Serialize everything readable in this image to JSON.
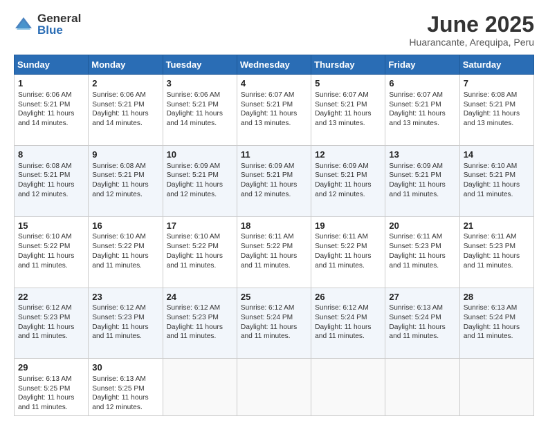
{
  "logo": {
    "general": "General",
    "blue": "Blue"
  },
  "header": {
    "month": "June 2025",
    "location": "Huarancante, Arequipa, Peru"
  },
  "weekdays": [
    "Sunday",
    "Monday",
    "Tuesday",
    "Wednesday",
    "Thursday",
    "Friday",
    "Saturday"
  ],
  "weeks": [
    [
      {
        "day": "1",
        "sunrise": "6:06 AM",
        "sunset": "5:21 PM",
        "daylight": "11 hours and 14 minutes."
      },
      {
        "day": "2",
        "sunrise": "6:06 AM",
        "sunset": "5:21 PM",
        "daylight": "11 hours and 14 minutes."
      },
      {
        "day": "3",
        "sunrise": "6:06 AM",
        "sunset": "5:21 PM",
        "daylight": "11 hours and 14 minutes."
      },
      {
        "day": "4",
        "sunrise": "6:07 AM",
        "sunset": "5:21 PM",
        "daylight": "11 hours and 13 minutes."
      },
      {
        "day": "5",
        "sunrise": "6:07 AM",
        "sunset": "5:21 PM",
        "daylight": "11 hours and 13 minutes."
      },
      {
        "day": "6",
        "sunrise": "6:07 AM",
        "sunset": "5:21 PM",
        "daylight": "11 hours and 13 minutes."
      },
      {
        "day": "7",
        "sunrise": "6:08 AM",
        "sunset": "5:21 PM",
        "daylight": "11 hours and 13 minutes."
      }
    ],
    [
      {
        "day": "8",
        "sunrise": "6:08 AM",
        "sunset": "5:21 PM",
        "daylight": "11 hours and 12 minutes."
      },
      {
        "day": "9",
        "sunrise": "6:08 AM",
        "sunset": "5:21 PM",
        "daylight": "11 hours and 12 minutes."
      },
      {
        "day": "10",
        "sunrise": "6:09 AM",
        "sunset": "5:21 PM",
        "daylight": "11 hours and 12 minutes."
      },
      {
        "day": "11",
        "sunrise": "6:09 AM",
        "sunset": "5:21 PM",
        "daylight": "11 hours and 12 minutes."
      },
      {
        "day": "12",
        "sunrise": "6:09 AM",
        "sunset": "5:21 PM",
        "daylight": "11 hours and 12 minutes."
      },
      {
        "day": "13",
        "sunrise": "6:09 AM",
        "sunset": "5:21 PM",
        "daylight": "11 hours and 11 minutes."
      },
      {
        "day": "14",
        "sunrise": "6:10 AM",
        "sunset": "5:21 PM",
        "daylight": "11 hours and 11 minutes."
      }
    ],
    [
      {
        "day": "15",
        "sunrise": "6:10 AM",
        "sunset": "5:22 PM",
        "daylight": "11 hours and 11 minutes."
      },
      {
        "day": "16",
        "sunrise": "6:10 AM",
        "sunset": "5:22 PM",
        "daylight": "11 hours and 11 minutes."
      },
      {
        "day": "17",
        "sunrise": "6:10 AM",
        "sunset": "5:22 PM",
        "daylight": "11 hours and 11 minutes."
      },
      {
        "day": "18",
        "sunrise": "6:11 AM",
        "sunset": "5:22 PM",
        "daylight": "11 hours and 11 minutes."
      },
      {
        "day": "19",
        "sunrise": "6:11 AM",
        "sunset": "5:22 PM",
        "daylight": "11 hours and 11 minutes."
      },
      {
        "day": "20",
        "sunrise": "6:11 AM",
        "sunset": "5:23 PM",
        "daylight": "11 hours and 11 minutes."
      },
      {
        "day": "21",
        "sunrise": "6:11 AM",
        "sunset": "5:23 PM",
        "daylight": "11 hours and 11 minutes."
      }
    ],
    [
      {
        "day": "22",
        "sunrise": "6:12 AM",
        "sunset": "5:23 PM",
        "daylight": "11 hours and 11 minutes."
      },
      {
        "day": "23",
        "sunrise": "6:12 AM",
        "sunset": "5:23 PM",
        "daylight": "11 hours and 11 minutes."
      },
      {
        "day": "24",
        "sunrise": "6:12 AM",
        "sunset": "5:23 PM",
        "daylight": "11 hours and 11 minutes."
      },
      {
        "day": "25",
        "sunrise": "6:12 AM",
        "sunset": "5:24 PM",
        "daylight": "11 hours and 11 minutes."
      },
      {
        "day": "26",
        "sunrise": "6:12 AM",
        "sunset": "5:24 PM",
        "daylight": "11 hours and 11 minutes."
      },
      {
        "day": "27",
        "sunrise": "6:13 AM",
        "sunset": "5:24 PM",
        "daylight": "11 hours and 11 minutes."
      },
      {
        "day": "28",
        "sunrise": "6:13 AM",
        "sunset": "5:24 PM",
        "daylight": "11 hours and 11 minutes."
      }
    ],
    [
      {
        "day": "29",
        "sunrise": "6:13 AM",
        "sunset": "5:25 PM",
        "daylight": "11 hours and 11 minutes."
      },
      {
        "day": "30",
        "sunrise": "6:13 AM",
        "sunset": "5:25 PM",
        "daylight": "11 hours and 12 minutes."
      },
      null,
      null,
      null,
      null,
      null
    ]
  ]
}
